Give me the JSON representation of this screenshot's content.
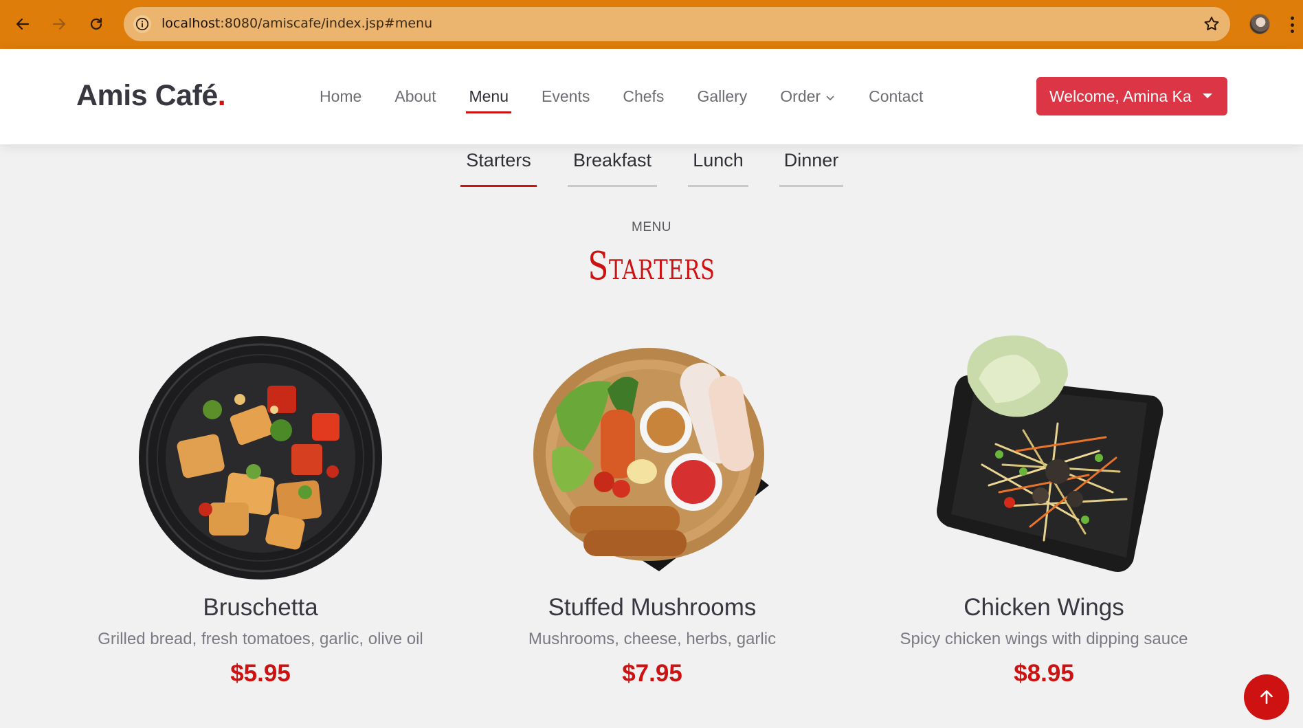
{
  "browser": {
    "url_host": "localhost",
    "url_rest": ":8080/amiscafe/index.jsp#menu"
  },
  "site": {
    "logo_text": "Amis Café",
    "logo_dot": ".",
    "nav": [
      "Home",
      "About",
      "Menu",
      "Events",
      "Chefs",
      "Gallery",
      "Order",
      "Contact"
    ],
    "active_nav": "Menu",
    "welcome": "Welcome, Amina Ka"
  },
  "tabs": [
    "Starters",
    "Breakfast",
    "Lunch",
    "Dinner"
  ],
  "active_tab": "Starters",
  "section": {
    "subtitle": "MENU",
    "title": "Starters"
  },
  "items": [
    {
      "name": "Bruschetta",
      "ingredients": "Grilled bread, fresh tomatoes, garlic, olive oil",
      "price": "$5.95",
      "image": "tofu-dish-on-black-bowl"
    },
    {
      "name": "Stuffed Mushrooms",
      "ingredients": "Mushrooms, cheese, herbs, garlic",
      "price": "$7.95",
      "image": "spring-rolls-basket-platter"
    },
    {
      "name": "Chicken Wings",
      "ingredients": "Spicy chicken wings with dipping sauce",
      "price": "$8.95",
      "image": "papaya-salad-black-plate"
    }
  ],
  "colors": {
    "accent": "#ce1212",
    "button": "#dc3545",
    "chrome": "#df7d0a"
  }
}
